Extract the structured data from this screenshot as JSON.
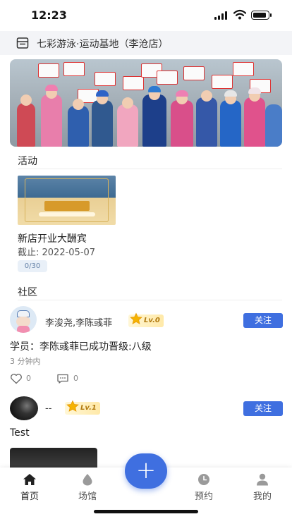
{
  "status_bar": {
    "time": "12:23"
  },
  "store": {
    "name": "七彩游泳·运动基地（李沧店）"
  },
  "sections": {
    "activities": "活动",
    "community": "社区"
  },
  "activity": {
    "title": "新店开业大酬宾",
    "deadline": "截止: 2022-05-07",
    "count": "0/30"
  },
  "posts": [
    {
      "user": "李浚尧,李陈彧菲",
      "level": "Lv.0",
      "follow_label": "关注",
      "text": "学员：李陈彧菲已成功晋级:八级",
      "time": "3 分钟内",
      "likes": "0",
      "comments": "0"
    },
    {
      "user": "--",
      "level": "Lv.1",
      "follow_label": "关注",
      "text": "Test"
    }
  ],
  "tabbar": {
    "items": [
      {
        "label": "首页",
        "icon": "home-icon"
      },
      {
        "label": "场馆",
        "icon": "venue-icon"
      },
      {
        "label": "预约",
        "icon": "clock-icon"
      },
      {
        "label": "我的",
        "icon": "user-icon"
      }
    ],
    "fab_label": "+"
  },
  "colors": {
    "accent": "#3f6fe0",
    "level_badge": "#ffe9a8",
    "count_badge": "#e9f0f8"
  }
}
